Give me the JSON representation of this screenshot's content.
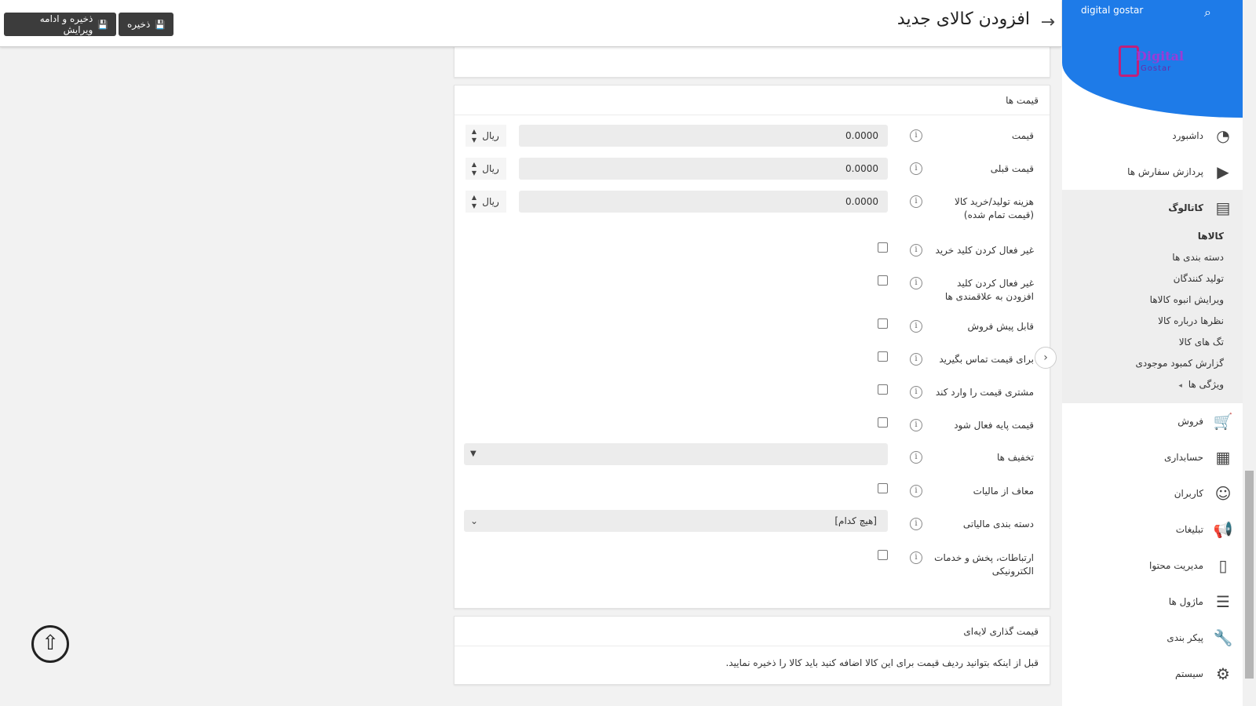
{
  "header": {
    "title": "افزودن کالای جدید",
    "save_label": "ذخیره",
    "save_continue_label": "ذخیره و ادامه ویرایش"
  },
  "sidebar": {
    "brand": "digital gostar",
    "logo_text": "Digital",
    "logo_sub": "Gostar",
    "menu": [
      {
        "label": "داشبورد",
        "icon": "dashboard-icon"
      },
      {
        "label": "پردازش سفارش ها",
        "icon": "play-circle-icon"
      }
    ],
    "catalog": {
      "label": "کاتالوگ",
      "icon": "book-icon",
      "items": [
        {
          "label": "کالاها"
        },
        {
          "label": "دسته بندی ها"
        },
        {
          "label": "تولید کنندگان"
        },
        {
          "label": "ویرایش انبوه کالاها"
        },
        {
          "label": "نظرها درباره کالا"
        },
        {
          "label": "تگ های کالا"
        },
        {
          "label": "گزارش کمبود موجودی"
        },
        {
          "label": "ویژگی ها"
        }
      ]
    },
    "menu_bottom": [
      {
        "label": "فروش",
        "icon": "cart-icon"
      },
      {
        "label": "حسابداری",
        "icon": "calculator-icon"
      },
      {
        "label": "کاربران",
        "icon": "user-icon"
      },
      {
        "label": "تبلیغات",
        "icon": "megaphone-icon"
      },
      {
        "label": "مدیریت محتوا",
        "icon": "document-icon"
      },
      {
        "label": "ماژول ها",
        "icon": "menu-icon"
      },
      {
        "label": "پیکر بندی",
        "icon": "wrench-icon"
      },
      {
        "label": "سیستم",
        "icon": "gears-icon"
      }
    ]
  },
  "prices_panel": {
    "title": "قیمت ها",
    "price": {
      "label": "قیمت",
      "value": "0.0000",
      "unit": "ریال"
    },
    "old_price": {
      "label": "قیمت قبلی",
      "value": "0.0000",
      "unit": "ریال"
    },
    "cost": {
      "label": "هزینه تولید/خرید کالا (قیمت تمام شده)",
      "value": "0.0000",
      "unit": "ریال"
    },
    "checkboxes": [
      {
        "label": "غیر فعال کردن کلید خرید",
        "checked": false
      },
      {
        "label": "غیر فعال کردن کلید افزودن به علاقمندی ها",
        "checked": false
      },
      {
        "label": "قابل پیش فروش",
        "checked": false
      },
      {
        "label": "برای قیمت تماس بگیرید",
        "checked": false
      },
      {
        "label": "مشتری قیمت را وارد کند",
        "checked": false
      },
      {
        "label": "قیمت پایه فعال شود",
        "checked": false
      }
    ],
    "discounts": {
      "label": "تخفیف ها",
      "value": ""
    },
    "tax_exempt": {
      "label": "معاف از مالیات",
      "checked": false
    },
    "tax_category": {
      "label": "دسته بندی مالیاتی",
      "value": "[هیچ کدام]"
    },
    "telecom": {
      "label": "ارتباطات، پخش و خدمات الکترونیکی",
      "checked": false
    }
  },
  "tier_panel": {
    "title": "قیمت گذاری لایه‌ای",
    "note": "قبل از اینکه بتوانید ردیف قیمت برای این کالا اضافه کنید باید کالا را ذخیره نمایید."
  }
}
